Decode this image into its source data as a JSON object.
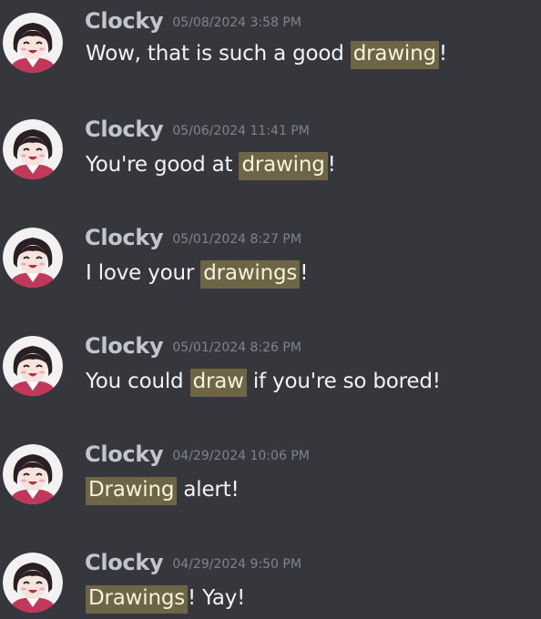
{
  "colors": {
    "background": "#36373d",
    "highlight": "#6e6547",
    "username": "#c2c5cc",
    "timestamp": "#7f838b",
    "text": "#f2f3f5"
  },
  "messages": [
    {
      "avatar_icon": "anime-girl-avatar-icon",
      "username": "Clocky",
      "timestamp": "05/08/2024 3:58 PM",
      "text_before": "Wow, that is such a good ",
      "highlight": "drawing",
      "text_after": "!"
    },
    {
      "avatar_icon": "anime-girl-avatar-icon",
      "username": "Clocky",
      "timestamp": "05/06/2024 11:41 PM",
      "text_before": "You're good at ",
      "highlight": "drawing",
      "text_after": "!"
    },
    {
      "avatar_icon": "anime-girl-avatar-icon",
      "username": "Clocky",
      "timestamp": "05/01/2024 8:27 PM",
      "text_before": "I love your ",
      "highlight": "drawings",
      "text_after": "!"
    },
    {
      "avatar_icon": "anime-girl-avatar-icon",
      "username": "Clocky",
      "timestamp": "05/01/2024 8:26 PM",
      "text_before": "You could ",
      "highlight": "draw",
      "text_after": " if you're so bored!"
    },
    {
      "avatar_icon": "anime-girl-avatar-icon",
      "username": "Clocky",
      "timestamp": "04/29/2024 10:06 PM",
      "text_before": "",
      "highlight": "Drawing",
      "text_after": " alert!"
    },
    {
      "avatar_icon": "anime-girl-avatar-icon",
      "username": "Clocky",
      "timestamp": "04/29/2024 9:50 PM",
      "text_before": "",
      "highlight": "Drawings",
      "text_after": "! Yay!"
    }
  ]
}
